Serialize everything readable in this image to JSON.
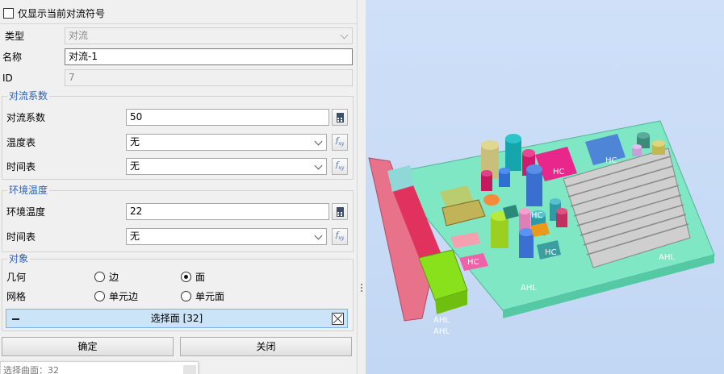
{
  "top": {
    "checkbox_label": "仅显示当前对流符号"
  },
  "general": {
    "type_label": "类型",
    "type_value": "对流",
    "name_label": "名称",
    "name_value": "对流-1",
    "id_label": "ID",
    "id_value": "7"
  },
  "coefficient": {
    "title": "对流系数",
    "value_label": "对流系数",
    "value": "50",
    "temp_table_label": "温度表",
    "temp_table_value": "无",
    "time_table_label": "时间表",
    "time_table_value": "无"
  },
  "ambient": {
    "title": "环境温度",
    "value_label": "环境温度",
    "value": "22",
    "time_table_label": "时间表",
    "time_table_value": "无"
  },
  "object": {
    "title": "对象",
    "geometry_label": "几何",
    "opt_edge": "边",
    "opt_face": "面",
    "mesh_label": "网格",
    "opt_elem_edge": "单元边",
    "opt_elem_face": "单元面",
    "selected_option": "面",
    "selection_text": "选择面 [32]"
  },
  "buttons": {
    "ok": "确定",
    "close": "关闭"
  },
  "tooltip": {
    "text": "选择曲面：32"
  },
  "viewport": {
    "tags": [
      "HC",
      "HC",
      "HC",
      "HC",
      "HC",
      "AHL",
      "AHL",
      "AHL",
      "AHL"
    ]
  },
  "colors": {
    "accent": "#2a63b8",
    "selection": "#cce4f7",
    "board": "#7fe7c4",
    "viewport_bg": "#c8dbf6"
  }
}
